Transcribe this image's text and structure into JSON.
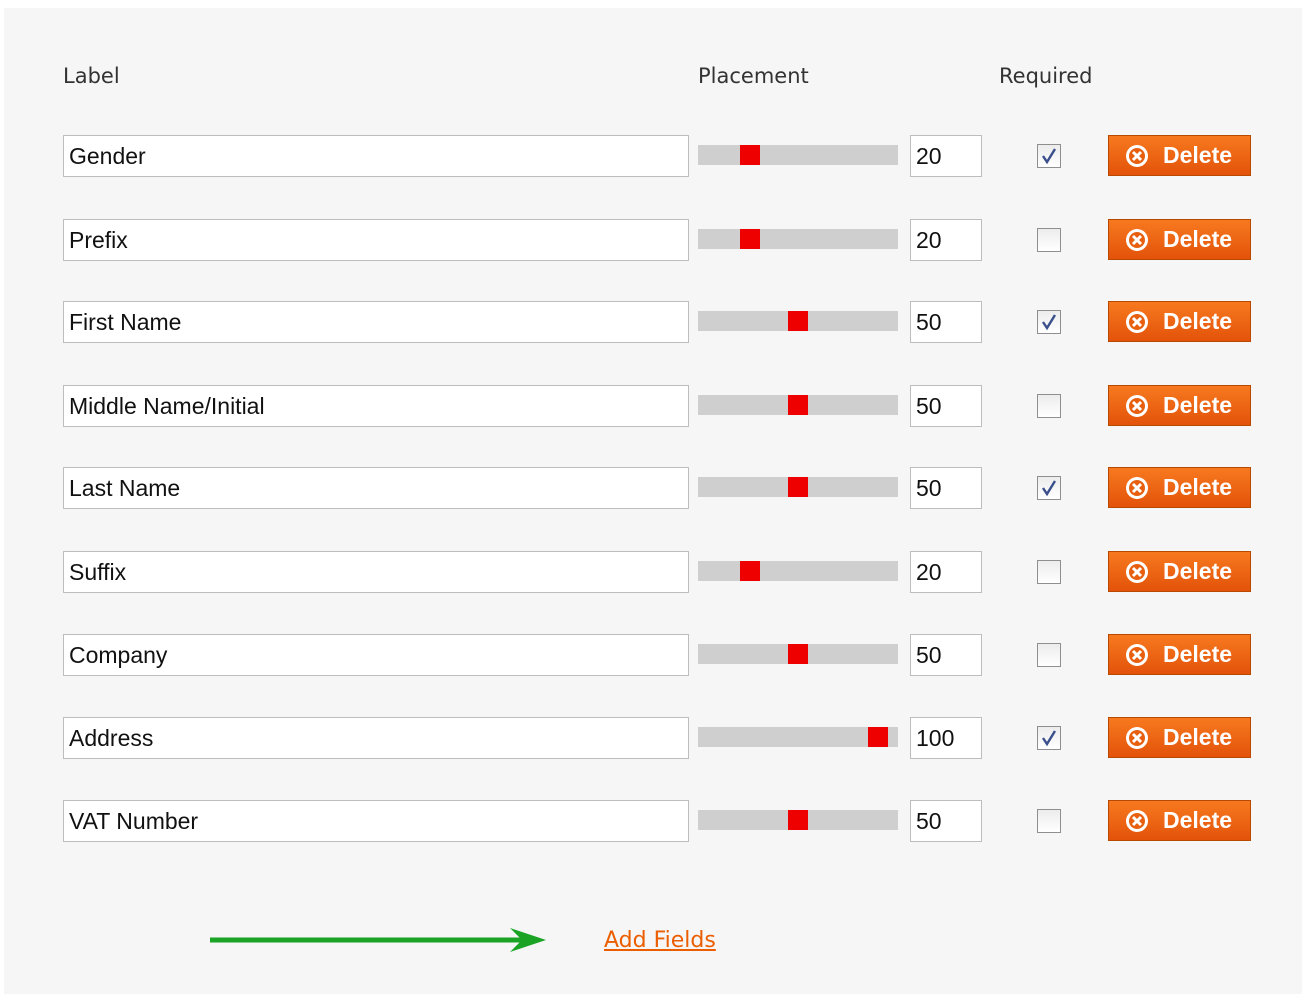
{
  "headers": {
    "label": "Label",
    "placement": "Placement",
    "required": "Required"
  },
  "fields": [
    {
      "label": "Gender",
      "placement": "20",
      "required": true
    },
    {
      "label": "Prefix",
      "placement": "20",
      "required": false
    },
    {
      "label": "First Name",
      "placement": "50",
      "required": true
    },
    {
      "label": "Middle Name/Initial",
      "placement": "50",
      "required": false
    },
    {
      "label": "Last Name",
      "placement": "50",
      "required": true
    },
    {
      "label": "Suffix",
      "placement": "20",
      "required": false
    },
    {
      "label": "Company",
      "placement": "50",
      "required": false
    },
    {
      "label": "Address",
      "placement": "100",
      "required": true
    },
    {
      "label": "VAT Number",
      "placement": "50",
      "required": false
    }
  ],
  "slider": {
    "min": 0,
    "max": 100
  },
  "delete_label": "Delete",
  "add_fields_label": "Add Fields",
  "icons": {
    "delete": "close-circle-icon",
    "arrow": "arrow-right-icon",
    "check": "checkmark-icon"
  },
  "colors": {
    "button": "#e8600f",
    "slider_thumb": "#ee0000",
    "slider_track": "#cfcfcf",
    "arrow": "#1aa324",
    "link": "#eb5e00"
  }
}
